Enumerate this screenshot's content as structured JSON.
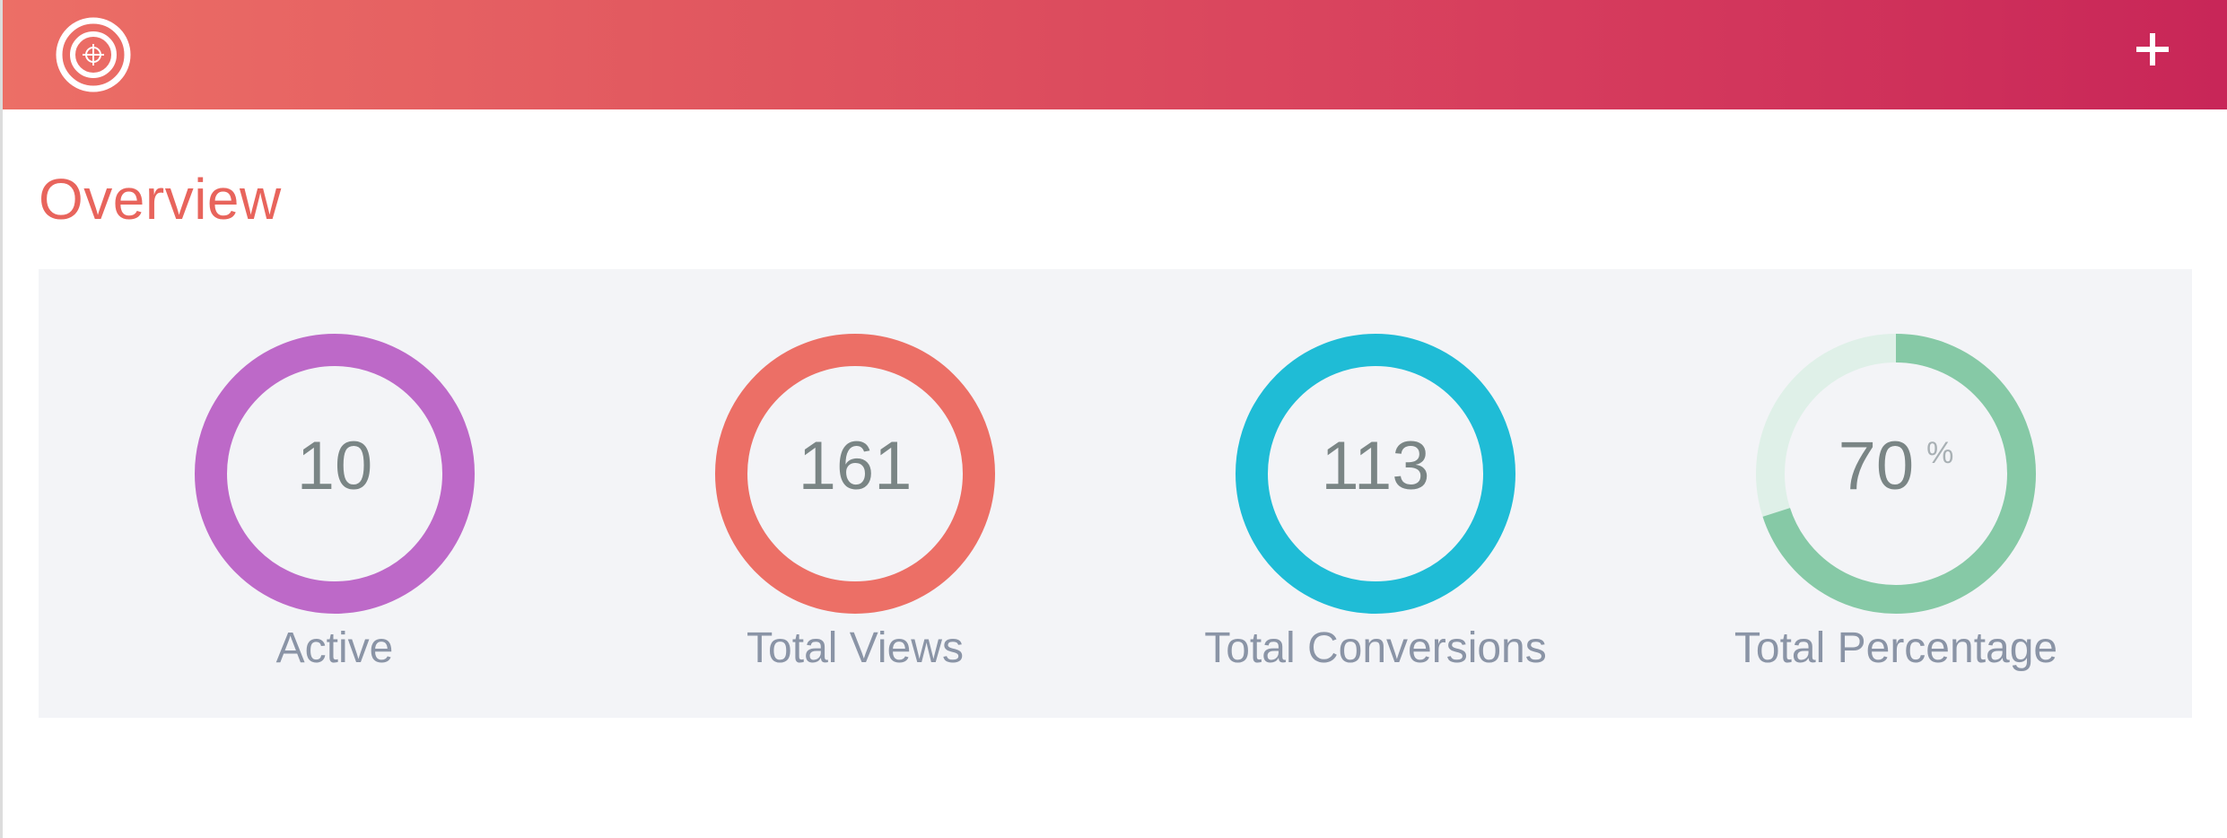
{
  "header": {
    "logo_icon": "target-icon",
    "add_icon": "plus-icon",
    "gradient_start": "#ec6f66",
    "gradient_end": "#c82658"
  },
  "page": {
    "title": "Overview"
  },
  "stats": [
    {
      "value": "10",
      "unit": "",
      "label": "Active",
      "color": "#bd69c8"
    },
    {
      "value": "161",
      "unit": "",
      "label": "Total Views",
      "color": "#ec6f66"
    },
    {
      "value": "113",
      "unit": "",
      "label": "Total Conversions",
      "color": "#1fbcd6"
    },
    {
      "value": "70",
      "unit": "%",
      "label": "Total Percentage",
      "color": "#86c9a6",
      "track_color": "#dff0e8",
      "progress": 0.7
    }
  ]
}
